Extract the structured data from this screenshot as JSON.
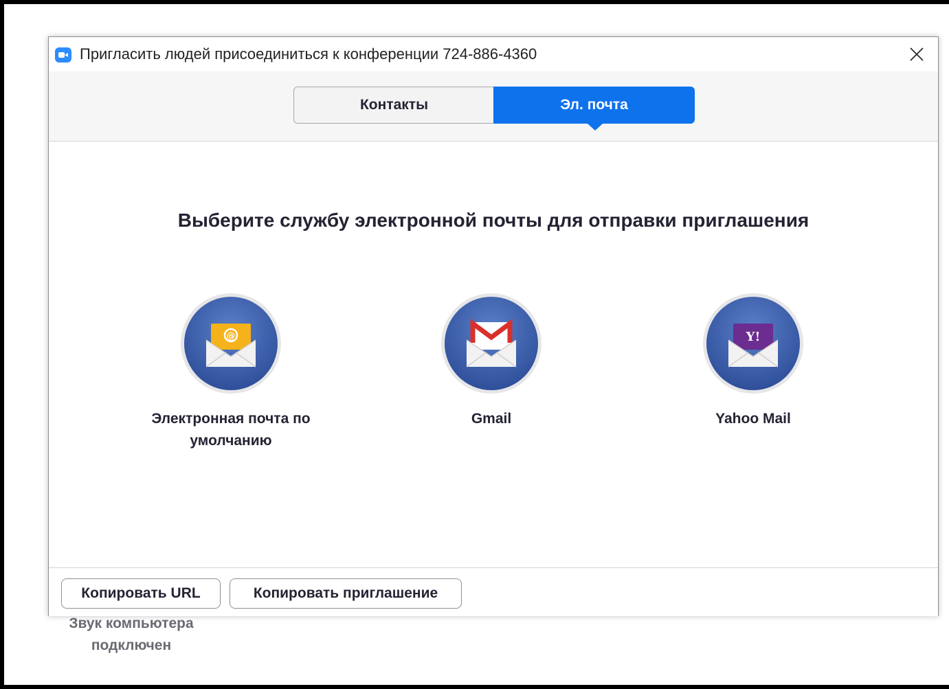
{
  "dialog": {
    "title": "Пригласить людей присоединиться к конференции 724-886-4360"
  },
  "tabs": [
    {
      "label": "Контакты",
      "active": false
    },
    {
      "label": "Эл. почта",
      "active": true
    }
  ],
  "main": {
    "heading": "Выберите службу электронной почты для отправки приглашения",
    "services": [
      {
        "label": "Электронная почта по умолчанию",
        "icon": "default-email-icon"
      },
      {
        "label": "Gmail",
        "icon": "gmail-icon"
      },
      {
        "label": "Yahoo Mail",
        "icon": "yahoo-mail-icon"
      }
    ]
  },
  "footer": {
    "copy_url_label": "Копировать URL",
    "copy_invite_label": "Копировать приглашение"
  },
  "background": {
    "status_text": "Звук компьютера подключен"
  },
  "colors": {
    "accent": "#0e72ed",
    "icon_blue": "#3b5ba8",
    "gmail_red": "#d9302b",
    "yahoo_purple": "#6b2d8f",
    "default_yellow": "#f5b21a"
  }
}
